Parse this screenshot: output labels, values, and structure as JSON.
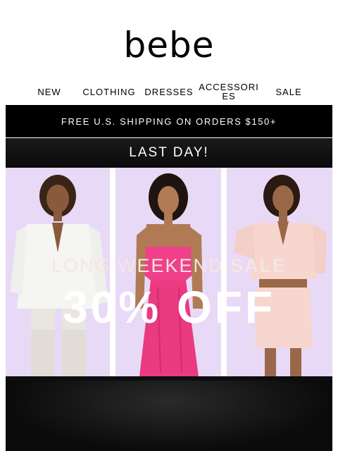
{
  "brand": {
    "logo": "bebe"
  },
  "nav": {
    "items": [
      {
        "label": "NEW"
      },
      {
        "label": "CLOTHING"
      },
      {
        "label": "DRESSES"
      },
      {
        "label": "ACCESSORIES"
      },
      {
        "label": "SALE"
      }
    ]
  },
  "promo": {
    "text": "FREE U.S. SHIPPING ON ORDERS $150+"
  },
  "hero": {
    "top_label": "LAST DAY!",
    "sale_title_light": "LONG WEEKEND ",
    "sale_title_bold": "SALE",
    "sale_offer": "30% OFF"
  },
  "colors": {
    "panel_background": "#e8d9f7",
    "white_blazer": "#f5f5f2",
    "pink_dress": "#f0408a",
    "blush_set": "#f6d6cf",
    "banner_black": "#000000"
  }
}
